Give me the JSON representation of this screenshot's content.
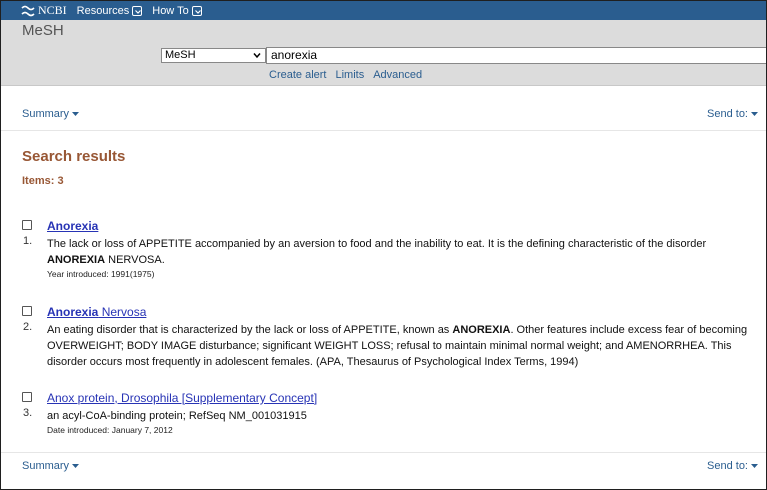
{
  "topbar": {
    "logo_text": "NCBI",
    "menu_resources": "Resources",
    "menu_howto": "How To"
  },
  "search": {
    "db_title": "MeSH",
    "db_selected": "MeSH",
    "query": "anorexia",
    "links": [
      "Create alert",
      "Limits",
      "Advanced"
    ]
  },
  "toolbar": {
    "summary_label": "Summary",
    "sendto_label": "Send to:"
  },
  "results": {
    "heading": "Search results",
    "items_label": "Items: 3",
    "items": [
      {
        "number": "1.",
        "title_bold": "Anorexia",
        "title_rest": "",
        "desc_parts": [
          {
            "t": "The lack or loss of APPETITE accompanied by an aversion to food and the inability to eat. It is the defining characteristic of the disorder ",
            "b": false
          },
          {
            "t": "ANOREXIA",
            "b": true
          },
          {
            "t": " NERVOSA.",
            "b": false
          }
        ],
        "meta": "Year introduced: 1991(1975)"
      },
      {
        "number": "2.",
        "title_bold": "Anorexia",
        "title_rest": " Nervosa",
        "desc_parts": [
          {
            "t": "An eating disorder that is characterized by the lack or loss of APPETITE, known as ",
            "b": false
          },
          {
            "t": "ANOREXIA",
            "b": true
          },
          {
            "t": ". Other features include excess fear of becoming OVERWEIGHT; BODY IMAGE disturbance; significant WEIGHT LOSS; refusal to maintain minimal normal weight; and AMENORRHEA. This disorder occurs most frequently in adolescent females. (APA, Thesaurus of Psychological Index Terms, 1994)",
            "b": false
          }
        ],
        "meta": ""
      },
      {
        "number": "3.",
        "title_bold": "",
        "title_rest": "Anox protein, Drosophila [Supplementary Concept]",
        "desc_parts": [
          {
            "t": "an acyl-CoA-binding protein; RefSeq NM_001031915",
            "b": false
          }
        ],
        "meta": "Date introduced: January 7, 2012"
      }
    ]
  },
  "colors": {
    "topbar": "#2a5d8f",
    "header": "#dcdcdc",
    "heading": "#985735",
    "link": "#2733b5"
  }
}
